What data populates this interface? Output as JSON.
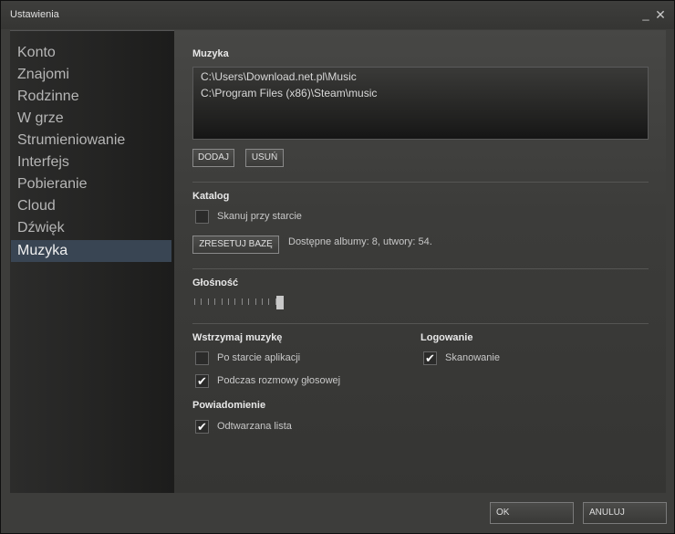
{
  "window": {
    "title": "Ustawienia",
    "minimize_glyph": "_",
    "close_glyph": "✕"
  },
  "sidebar": {
    "items": [
      {
        "label": "Konto",
        "active": false
      },
      {
        "label": "Znajomi",
        "active": false
      },
      {
        "label": "Rodzinne",
        "active": false
      },
      {
        "label": "W grze",
        "active": false
      },
      {
        "label": "Strumieniowanie",
        "active": false
      },
      {
        "label": "Interfejs",
        "active": false
      },
      {
        "label": "Pobieranie",
        "active": false
      },
      {
        "label": "Cloud",
        "active": false
      },
      {
        "label": "Dźwięk",
        "active": false
      },
      {
        "label": "Muzyka",
        "active": true
      }
    ]
  },
  "music": {
    "title": "Muzyka",
    "paths": [
      "C:\\Users\\Download.net.pl\\Music",
      "C:\\Program Files (x86)\\Steam\\music"
    ],
    "add_label": "DODAJ",
    "remove_label": "USUŃ"
  },
  "catalog": {
    "title": "Katalog",
    "scan_on_start": {
      "label": "Skanuj przy starcie",
      "checked": false
    },
    "reset_label": "ZRESETUJ BAZĘ",
    "stats": "Dostępne albumy: 8, utwory: 54."
  },
  "volume": {
    "title": "Głośność",
    "level_fraction": 1.0
  },
  "pause": {
    "title": "Wstrzymaj muzykę",
    "after_app_start": {
      "label": "Po starcie aplikacji",
      "checked": false
    },
    "during_voice": {
      "label": "Podczas rozmowy głosowej",
      "checked": true
    }
  },
  "logging": {
    "title": "Logowanie",
    "scanning": {
      "label": "Skanowanie",
      "checked": true
    }
  },
  "notification": {
    "title": "Powiadomienie",
    "playlist": {
      "label": "Odtwarzana lista",
      "checked": true
    }
  },
  "footer": {
    "ok_label": "OK",
    "cancel_label": "ANULUJ"
  },
  "colors": {
    "active_item_bg": "#394553",
    "window_bg": "#3d3d3b"
  }
}
